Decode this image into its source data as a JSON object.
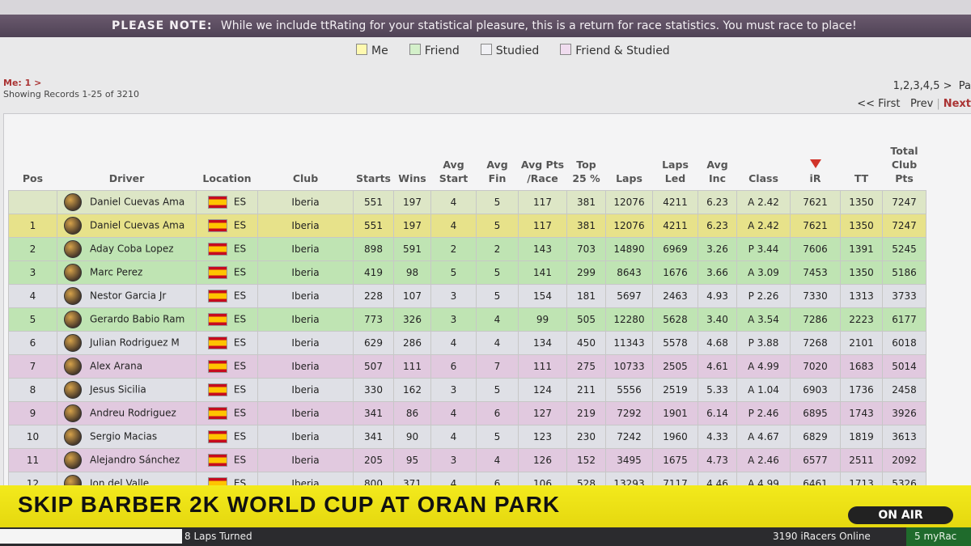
{
  "notice": {
    "label": "PLEASE NOTE:",
    "text": "While we include ttRating for your statistical pleasure, this is a return for race statistics. You must race to place!"
  },
  "legend": [
    {
      "label": "Me",
      "color": "#e7e28a"
    },
    {
      "label": "Friend",
      "color": "#bfe4b3"
    },
    {
      "label": "Studied",
      "color": "#dfe0e6"
    },
    {
      "label": "Friend & Studied",
      "color": "#e1c9df"
    }
  ],
  "meta": {
    "crumb": "Me: 1 >",
    "records": "Showing Records 1-25 of 3210"
  },
  "pager": {
    "pages": "1,2,3,4,5 >",
    "pa": "Pa",
    "first": "<< First",
    "prev": "Prev",
    "next": "Next"
  },
  "columns": [
    "Pos",
    "Driver",
    "Location",
    "Club",
    "Starts",
    "Wins",
    "Avg Start",
    "Avg Fin",
    "Avg Pts /Race",
    "Top 25 %",
    "Laps",
    "Laps Led",
    "Avg Inc",
    "Class",
    "iR",
    "TT",
    "Total Club Pts"
  ],
  "rows": [
    {
      "type": "you",
      "pos": "",
      "driver": "Daniel Cuevas Ama",
      "loc": "ES",
      "club": "Iberia",
      "starts": "551",
      "wins": "197",
      "avs": "4",
      "avf": "5",
      "avp": "117",
      "top": "381",
      "laps": "12076",
      "led": "4211",
      "inc": "6.23",
      "cls": "A 2.42",
      "ir": "7621",
      "tt": "1350",
      "pts": "7247"
    },
    {
      "type": "me",
      "pos": "1",
      "driver": "Daniel Cuevas Ama",
      "loc": "ES",
      "club": "Iberia",
      "starts": "551",
      "wins": "197",
      "avs": "4",
      "avf": "5",
      "avp": "117",
      "top": "381",
      "laps": "12076",
      "led": "4211",
      "inc": "6.23",
      "cls": "A 2.42",
      "ir": "7621",
      "tt": "1350",
      "pts": "7247"
    },
    {
      "type": "friend",
      "pos": "2",
      "driver": "Aday Coba Lopez",
      "loc": "ES",
      "club": "Iberia",
      "starts": "898",
      "wins": "591",
      "avs": "2",
      "avf": "2",
      "avp": "143",
      "top": "703",
      "laps": "14890",
      "led": "6969",
      "inc": "3.26",
      "cls": "P 3.44",
      "ir": "7606",
      "tt": "1391",
      "pts": "5245"
    },
    {
      "type": "friend",
      "pos": "3",
      "driver": "Marc Perez",
      "loc": "ES",
      "club": "Iberia",
      "starts": "419",
      "wins": "98",
      "avs": "5",
      "avf": "5",
      "avp": "141",
      "top": "299",
      "laps": "8643",
      "led": "1676",
      "inc": "3.66",
      "cls": "A 3.09",
      "ir": "7453",
      "tt": "1350",
      "pts": "5186"
    },
    {
      "type": "studied",
      "pos": "4",
      "driver": "Nestor Garcia Jr",
      "loc": "ES",
      "club": "Iberia",
      "starts": "228",
      "wins": "107",
      "avs": "3",
      "avf": "5",
      "avp": "154",
      "top": "181",
      "laps": "5697",
      "led": "2463",
      "inc": "4.93",
      "cls": "P 2.26",
      "ir": "7330",
      "tt": "1313",
      "pts": "3733"
    },
    {
      "type": "friend",
      "pos": "5",
      "driver": "Gerardo Babio Ram",
      "loc": "ES",
      "club": "Iberia",
      "starts": "773",
      "wins": "326",
      "avs": "3",
      "avf": "4",
      "avp": "99",
      "top": "505",
      "laps": "12280",
      "led": "5628",
      "inc": "3.40",
      "cls": "A 3.54",
      "ir": "7286",
      "tt": "2223",
      "pts": "6177"
    },
    {
      "type": "studied",
      "pos": "6",
      "driver": "Julian Rodriguez M",
      "loc": "ES",
      "club": "Iberia",
      "starts": "629",
      "wins": "286",
      "avs": "4",
      "avf": "4",
      "avp": "134",
      "top": "450",
      "laps": "11343",
      "led": "5578",
      "inc": "4.68",
      "cls": "P 3.88",
      "ir": "7268",
      "tt": "2101",
      "pts": "6018"
    },
    {
      "type": "fs",
      "pos": "7",
      "driver": "Alex Arana",
      "loc": "ES",
      "club": "Iberia",
      "starts": "507",
      "wins": "111",
      "avs": "6",
      "avf": "7",
      "avp": "111",
      "top": "275",
      "laps": "10733",
      "led": "2505",
      "inc": "4.61",
      "cls": "A 4.99",
      "ir": "7020",
      "tt": "1683",
      "pts": "5014"
    },
    {
      "type": "studied",
      "pos": "8",
      "driver": "Jesus Sicilia",
      "loc": "ES",
      "club": "Iberia",
      "starts": "330",
      "wins": "162",
      "avs": "3",
      "avf": "5",
      "avp": "124",
      "top": "211",
      "laps": "5556",
      "led": "2519",
      "inc": "5.33",
      "cls": "A 1.04",
      "ir": "6903",
      "tt": "1736",
      "pts": "2458"
    },
    {
      "type": "fs",
      "pos": "9",
      "driver": "Andreu Rodriguez",
      "loc": "ES",
      "club": "Iberia",
      "starts": "341",
      "wins": "86",
      "avs": "4",
      "avf": "6",
      "avp": "127",
      "top": "219",
      "laps": "7292",
      "led": "1901",
      "inc": "6.14",
      "cls": "P 2.46",
      "ir": "6895",
      "tt": "1743",
      "pts": "3926"
    },
    {
      "type": "studied",
      "pos": "10",
      "driver": "Sergio Macias",
      "loc": "ES",
      "club": "Iberia",
      "starts": "341",
      "wins": "90",
      "avs": "4",
      "avf": "5",
      "avp": "123",
      "top": "230",
      "laps": "7242",
      "led": "1960",
      "inc": "4.33",
      "cls": "A 4.67",
      "ir": "6829",
      "tt": "1819",
      "pts": "3613"
    },
    {
      "type": "fs",
      "pos": "11",
      "driver": "Alejandro Sánchez",
      "loc": "ES",
      "club": "Iberia",
      "starts": "205",
      "wins": "95",
      "avs": "3",
      "avf": "4",
      "avp": "126",
      "top": "152",
      "laps": "3495",
      "led": "1675",
      "inc": "4.73",
      "cls": "A 2.46",
      "ir": "6577",
      "tt": "2511",
      "pts": "2092"
    },
    {
      "type": "studied",
      "pos": "12",
      "driver": "Jon del Valle",
      "loc": "ES",
      "club": "Iberia",
      "starts": "800",
      "wins": "371",
      "avs": "4",
      "avf": "6",
      "avp": "106",
      "top": "528",
      "laps": "13293",
      "led": "7117",
      "inc": "4.46",
      "cls": "A 4.99",
      "ir": "6461",
      "tt": "1713",
      "pts": "5326"
    }
  ],
  "ticker": {
    "headline": "SKIP BARBER 2K WORLD CUP AT ORAN PARK",
    "onair": "ON AIR"
  },
  "status": {
    "laps": "8 Laps Turned",
    "online": "3190 iRacers Online",
    "mine": "5 myRac"
  }
}
